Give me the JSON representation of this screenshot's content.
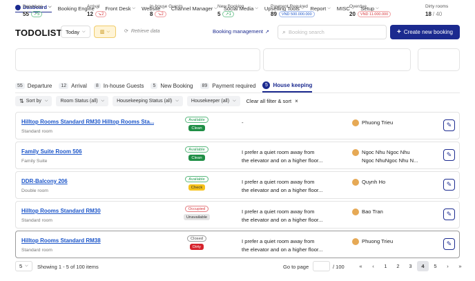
{
  "nav": {
    "items": [
      {
        "label": "Dasboard",
        "active": true
      },
      {
        "label": "Booking Engine"
      },
      {
        "label": "Front Desk"
      },
      {
        "label": "Website"
      },
      {
        "label": "Channel Manager"
      },
      {
        "label": "Social Media"
      },
      {
        "label": "Upselling Tools"
      },
      {
        "label": "Report"
      },
      {
        "label": "MISC"
      },
      {
        "label": "Setup"
      }
    ]
  },
  "header": {
    "title": "TODOLIST",
    "date_filter": "Today",
    "retrieve_label": "Retrieve data",
    "booking_management": "Booking management",
    "search_placeholder": "Booking search",
    "create_button": "Create new booking"
  },
  "stats": {
    "departure": {
      "label": "Departure",
      "value": "55",
      "delta": "5",
      "trend": "up"
    },
    "arrival": {
      "label": "Arrival",
      "value": "12",
      "delta": "2",
      "trend": "down"
    },
    "inhouse": {
      "label": "In-house Guests",
      "value": "8",
      "delta": "2",
      "trend": "down"
    },
    "new_booking": {
      "label": "New Booking",
      "value": "5",
      "delta": "1",
      "trend": "up"
    },
    "payment_required": {
      "label": "Payment Required",
      "value": "89",
      "amount": "VND 500.000.000"
    },
    "overdue": {
      "label": "Overdue",
      "value": "20",
      "amount": "VND 11.000.000"
    },
    "dirty_rooms": {
      "label": "Dirty rooms",
      "value": "18",
      "total": "/ 40"
    }
  },
  "tabs": [
    {
      "count": "55",
      "label": "Departure"
    },
    {
      "count": "12",
      "label": "Arrival"
    },
    {
      "count": "8",
      "label": "In-house Guests"
    },
    {
      "count": "5",
      "label": "New Booking"
    },
    {
      "count": "89",
      "label": "Payment required"
    },
    {
      "count": "5",
      "label": "House keeping",
      "active": true
    }
  ],
  "filters": {
    "sort": "Sort by",
    "room_status": "Room Status (all)",
    "housekeeping_status": "Housekeeping Status (all)",
    "housekeeper": "Housekeeper (all)",
    "clear": "Clear all filter & sort"
  },
  "rooms": [
    {
      "name": "Hilltop Rooms Standard RM30 Hilltop Rooms Sta...",
      "type": "Standard room",
      "status": "Available",
      "status_color": "green",
      "hk": "Clean",
      "hk_color": "green",
      "note_line1": "-",
      "note_line2": "",
      "keeper_line1": "Phuong Trieu",
      "keeper_line2": ""
    },
    {
      "name": "Family Suite Room 506",
      "type": "Family Suite",
      "status": "Available",
      "status_color": "green",
      "hk": "Clean",
      "hk_color": "green",
      "note_line1": "I prefer a quiet room away from",
      "note_line2": "the elevator and on a higher floor...",
      "keeper_line1": "Ngoc Nhu Ngoc Nhu",
      "keeper_line2": "Ngoc NhuNgoc Nhu N..."
    },
    {
      "name": "DDR-Balcony 206",
      "type": "Double room",
      "status": "Available",
      "status_color": "green",
      "hk": "Check",
      "hk_color": "yellow",
      "note_line1": "I prefer a quiet room away from",
      "note_line2": "the elevator and on a higher floor...",
      "keeper_line1": "Quynh Ho",
      "keeper_line2": ""
    },
    {
      "name": "Hilltop Rooms Standard RM30",
      "type": "Standard room",
      "status": "Occupied",
      "status_color": "red",
      "hk": "Unavailable",
      "hk_color": "gray",
      "note_line1": "I prefer a quiet room away from",
      "note_line2": "the elevator and on a higher floor...",
      "keeper_line1": "Bao Tran",
      "keeper_line2": ""
    },
    {
      "name": "Hilltop Rooms Standard RM38",
      "type": "Standard room",
      "status": "Closed",
      "status_color": "gray",
      "hk": "Dirty",
      "hk_color": "red",
      "note_line1": "I prefer a quiet room away from",
      "note_line2": "the elevator and on a higher floor...",
      "keeper_line1": "Phuong Trieu",
      "keeper_line2": ""
    }
  ],
  "footer": {
    "page_size": "5",
    "showing": "Showing 1 - 5 of 100 items",
    "goto_label": "Go to page",
    "total_pages": "/ 100",
    "pages": [
      "1",
      "2",
      "3",
      "4",
      "5"
    ],
    "current_page": "4"
  },
  "colors": {
    "primary": "#1b2a8f",
    "link": "#1b55c9",
    "green": "#1e8e45",
    "red": "#d6232c",
    "yellow": "#f6c21a"
  }
}
